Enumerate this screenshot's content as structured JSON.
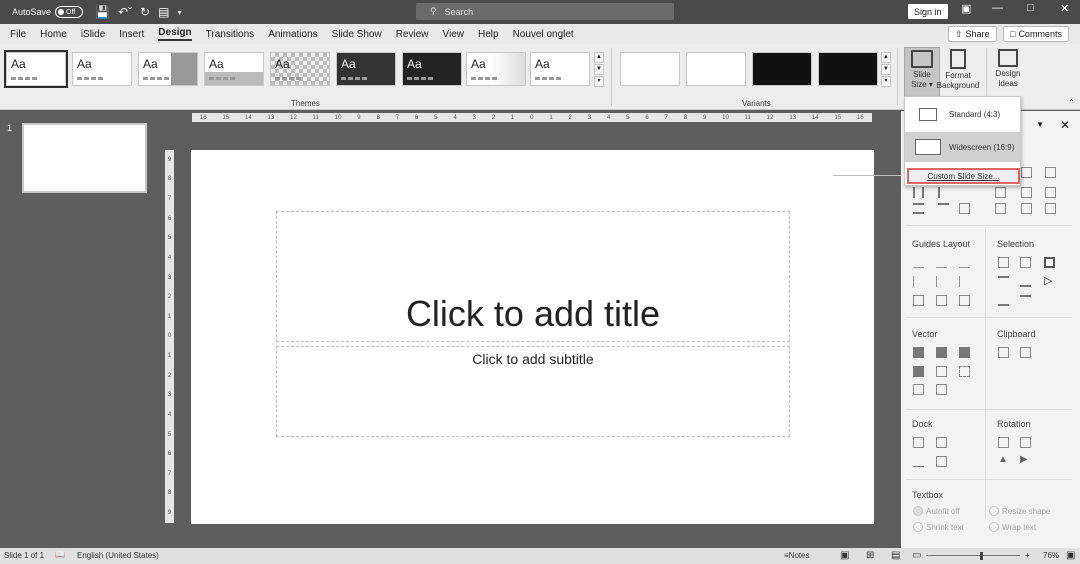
{
  "titlebar": {
    "autosave_label": "AutoSave",
    "autosave_state": "Off",
    "search_placeholder": "Search",
    "signin": "Sign in"
  },
  "tabs": [
    "File",
    "Home",
    "iSlide",
    "Insert",
    "Design",
    "Transitions",
    "Animations",
    "Slide Show",
    "Review",
    "View",
    "Help",
    "Nouvel onglet"
  ],
  "active_tab": "Design",
  "header_buttons": {
    "share": "Share",
    "comments": "Comments"
  },
  "ribbon": {
    "theme_label": "Aa",
    "themes_group": "Themes",
    "variants_group": "Variants",
    "slide_size": "Slide Size",
    "format_background": "Format Background",
    "design_ideas": "Design Ideas"
  },
  "dropdown": {
    "standard": "Standard (4:3)",
    "widescreen": "Widescreen (16:9)",
    "custom": "Custom Slide Size..."
  },
  "slides_pane": {
    "slide_number": "1"
  },
  "ruler": {
    "horizontal": [
      "16",
      "15",
      "14",
      "13",
      "12",
      "11",
      "10",
      "9",
      "8",
      "7",
      "6",
      "5",
      "4",
      "3",
      "2",
      "1",
      "0",
      "1",
      "2",
      "3",
      "4",
      "5",
      "6",
      "7",
      "8",
      "9",
      "10",
      "11",
      "12",
      "13",
      "14",
      "15",
      "16"
    ],
    "vertical": [
      "9",
      "8",
      "7",
      "6",
      "5",
      "4",
      "3",
      "2",
      "1",
      "0",
      "1",
      "2",
      "3",
      "4",
      "5",
      "6",
      "7",
      "8",
      "9"
    ]
  },
  "slide": {
    "title_placeholder": "Click to add title",
    "subtitle_placeholder": "Click to add subtitle"
  },
  "pane": {
    "guides_layout": "Guides Layout",
    "selection": "Selection",
    "vector": "Vector",
    "clipboard": "Clipboard",
    "dock": "Dock",
    "rotation": "Rotation",
    "textbox": "Textbox",
    "autofit_off": "Autofit off",
    "resize_shape": "Resize shape",
    "shrink_text": "Shrink text",
    "wrap_text": "Wrap text"
  },
  "statusbar": {
    "slide_info": "Slide 1 of 1",
    "language": "English (United States)",
    "notes": "Notes",
    "zoom": "76%"
  }
}
